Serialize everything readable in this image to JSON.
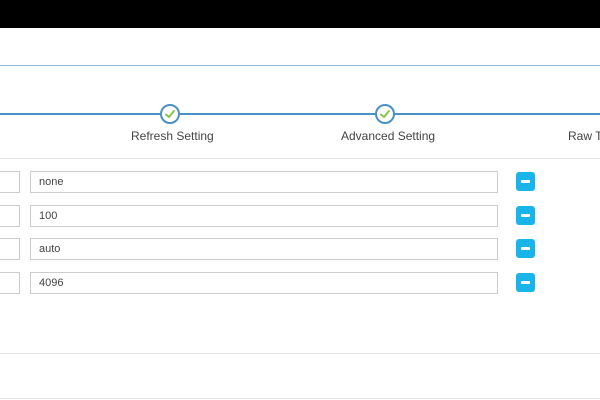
{
  "wizard": {
    "steps": [
      {
        "label": "Refresh Setting",
        "done": true
      },
      {
        "label": "Advanced Setting",
        "done": true
      },
      {
        "label": "Raw T",
        "done": false
      }
    ]
  },
  "rows": [
    {
      "value": "none"
    },
    {
      "value": "100"
    },
    {
      "value": "auto"
    },
    {
      "value": "4096"
    }
  ],
  "colors": {
    "accent": "#4a90c4",
    "check": "#8bc34a",
    "remove_button": "#19b5ea"
  }
}
